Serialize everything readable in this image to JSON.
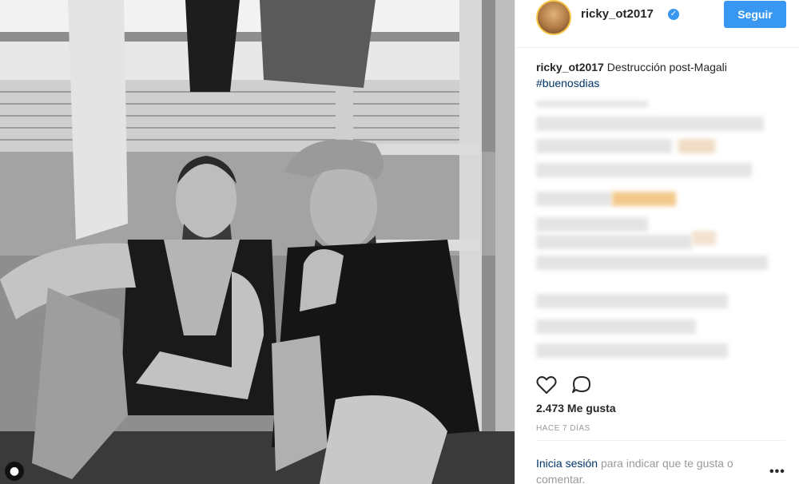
{
  "post": {
    "username": "ricky_ot2017",
    "follow_label": "Seguir",
    "caption_text": "Destrucción post-Magali",
    "hashtag": "#buenosdias",
    "likes": "2.473 Me gusta",
    "time": "HACE 7 DÍAS",
    "login_link": "Inicia sesión",
    "login_rest": "para indicar que te gusta o comentar."
  },
  "icons": {
    "verified": "verified-badge-icon",
    "heart": "heart-icon",
    "comment": "comment-icon",
    "more": "more-options-icon",
    "tag": "user-tag-icon"
  },
  "colors": {
    "accent": "#3897f0",
    "link": "#003569",
    "text": "#262626",
    "muted": "#999999"
  }
}
